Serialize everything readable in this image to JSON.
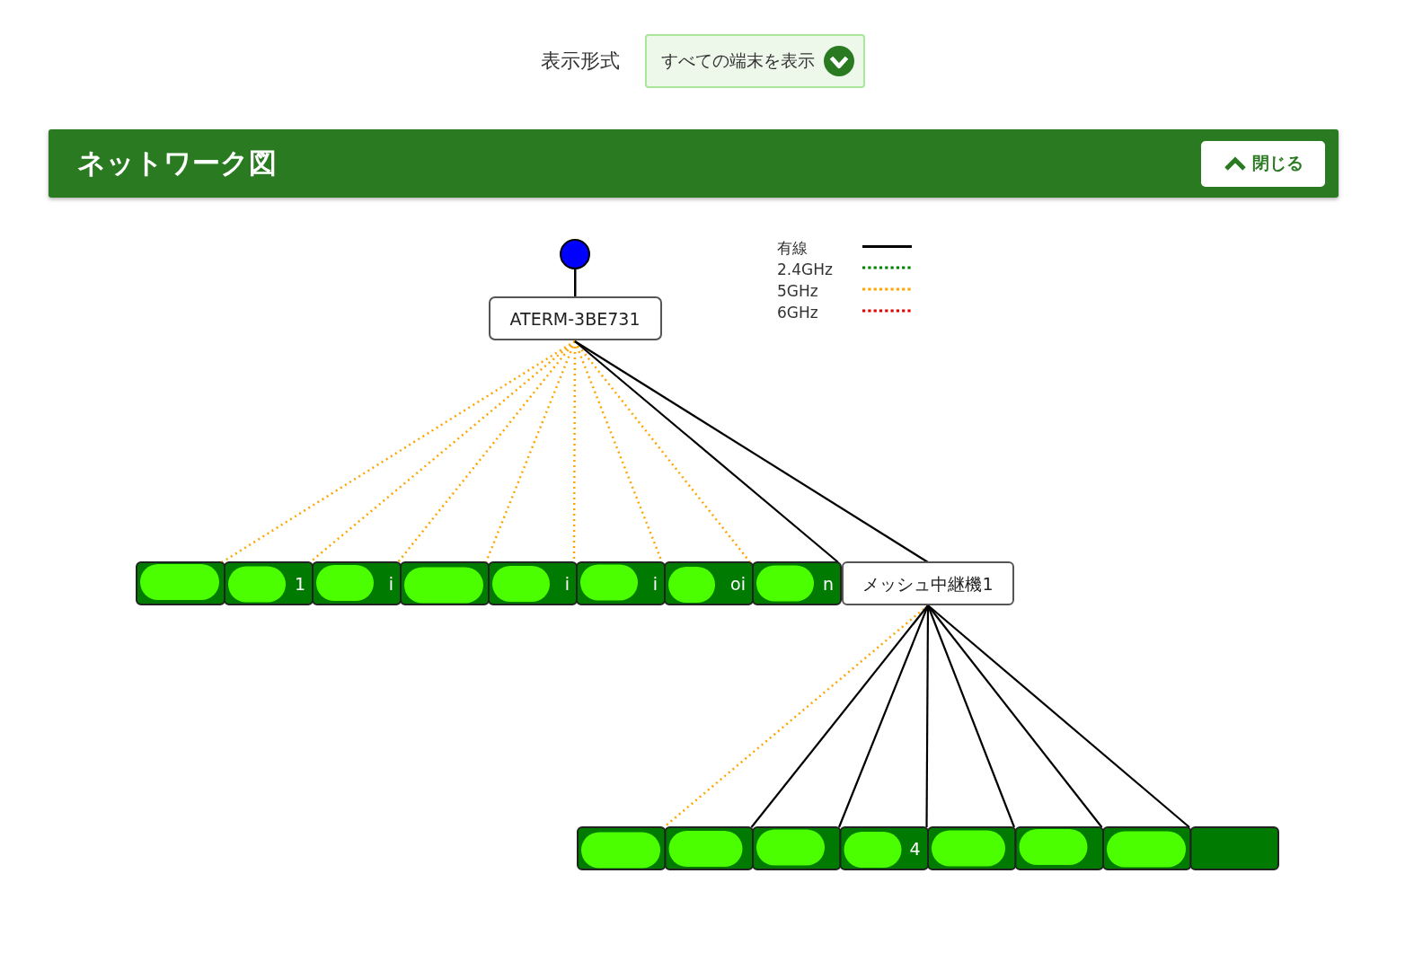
{
  "filter": {
    "label": "表示形式",
    "value": "すべての端末を表示"
  },
  "panel": {
    "title": "ネットワーク図",
    "close_button": "閉じる"
  },
  "legend": [
    {
      "label": "有線",
      "kind": "wired",
      "color": "#000000"
    },
    {
      "label": "2.4GHz",
      "kind": "dotted",
      "color": "#008000"
    },
    {
      "label": "5GHz",
      "kind": "dotted",
      "color": "#ffa500"
    },
    {
      "label": "6GHz",
      "kind": "dotted",
      "color": "#e00000"
    }
  ],
  "router": {
    "name": "ATERM-3BE731"
  },
  "devices": [
    {
      "kind": "wireless"
    },
    {
      "text": "1",
      "kind": "wireless"
    },
    {
      "text": "i",
      "kind": "wireless"
    },
    {
      "kind": "wireless"
    },
    {
      "text": "i",
      "kind": "wireless"
    },
    {
      "text": "i",
      "kind": "wireless"
    },
    {
      "text": "oi",
      "kind": "wireless"
    },
    {
      "text": "n",
      "kind": "wired"
    }
  ],
  "mesh": {
    "name": "メッシュ中継機1",
    "kind": "wired",
    "devices": [
      {
        "kind": "wireless"
      },
      {
        "kind": "wired"
      },
      {
        "kind": "wired"
      },
      {
        "text": "4",
        "kind": "wired"
      },
      {
        "kind": "wired"
      },
      {
        "kind": "wired"
      },
      {
        "kind": "wired"
      },
      {
        "kind": "unlinked"
      }
    ]
  }
}
